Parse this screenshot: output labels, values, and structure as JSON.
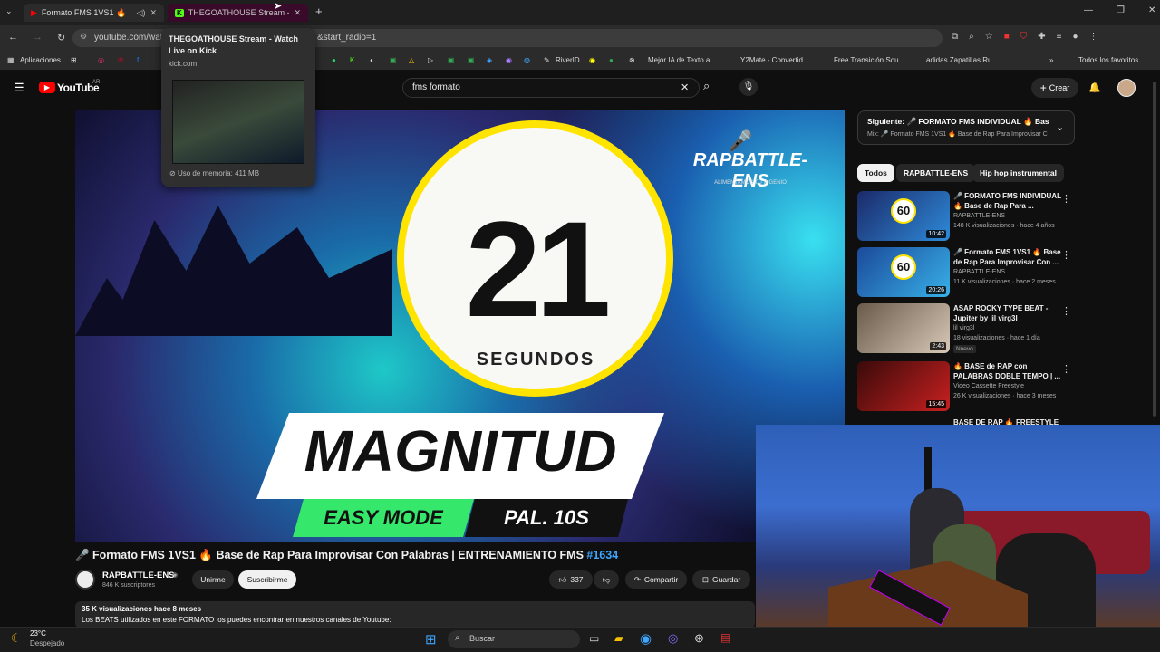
{
  "browser": {
    "tabs": [
      {
        "title": "Formato FMS 1VS1 🔥"
      },
      {
        "title": "THEGOATHOUSE Stream - Watch Live on Kick"
      }
    ],
    "url_visible": "youtube.com/wat",
    "url_tail": "&start_radio=1",
    "bookmarks": [
      "Aplicaciones",
      "RiverID",
      "Mejor IA de Texto a...",
      "Y2Mate - Convertid...",
      "Free Transición Sou...",
      "adidas Zapatillas Ru...",
      "Todos los favoritos"
    ]
  },
  "hover_card": {
    "title": "THEGOATHOUSE Stream - Watch Live on Kick",
    "domain": "kick.com",
    "memory": "Uso de memoria: 411 MB"
  },
  "youtube": {
    "logo": "YouTube",
    "country": "AR",
    "search_value": "fms formato",
    "create_label": "Crear"
  },
  "video": {
    "thumb_number": "21",
    "thumb_seconds": "SEGUNDOS",
    "thumb_word": "MAGNITUD",
    "thumb_mode": "EASY MODE",
    "thumb_pal": "PAL. 10S",
    "thumb_brand": "RAPBATTLE-ENS",
    "thumb_brand_sub": "ALIMENTAMOS TU INGENIO",
    "title": "🎤 Formato FMS 1VS1 🔥 Base de Rap Para Improvisar Con Palabras | ENTRENAMIENTO FMS",
    "hashtag": "#1634",
    "channel": "RAPBATTLE-ENS",
    "subscribers": "846 K suscriptores",
    "join_label": "Unirme",
    "subscribe_label": "Suscribirme",
    "likes": "337",
    "share_label": "Compartir",
    "save_label": "Guardar",
    "views": "35 K visualizaciones  hace 8 meses",
    "desc_line": "Los BEATS utilizados en este FORMATO los puedes encontrar en nuestros canales de Youtube:"
  },
  "sidebar": {
    "next_label": "Siguiente: 🎤 FORMATO FMS INDIVIDUAL 🔥 Base...",
    "mix_label": "Mix: 🎤 Formato FMS 1VS1 🔥 Base de Rap Para Improvisar C",
    "chips": [
      "Todos",
      "RAPBATTLE-ENS",
      "Hip hop instrumental"
    ],
    "items": [
      {
        "title": "🎤 FORMATO FMS INDIVIDUAL\n🔥 Base de Rap Para ...",
        "channel": "RAPBATTLE-ENS",
        "meta": "148 K visualizaciones · hace 4 años",
        "duration": "10:42",
        "badge": ""
      },
      {
        "title": "🎤 Formato FMS 1VS1 🔥 Base\nde Rap Para Improvisar Con ...",
        "channel": "RAPBATTLE-ENS",
        "meta": "11 K visualizaciones · hace 2 meses",
        "duration": "20:26",
        "badge": ""
      },
      {
        "title": "ASAP ROCKY TYPE BEAT -\nJupiter by lil virg3l",
        "channel": "lil virg3l",
        "meta": "18 visualizaciones · hace 1 día",
        "duration": "2:43",
        "badge": "Nuevo"
      },
      {
        "title": "🔥 BASE de RAP con\nPALABRAS DOBLE TEMPO | ...",
        "channel": "Video Cassette Freestyle",
        "meta": "26 K visualizaciones · hace 3 meses",
        "duration": "15:45",
        "badge": ""
      },
      {
        "title": "BASE DE RAP 🔥 FREESTYLE",
        "channel": "",
        "meta": "",
        "duration": "",
        "badge": ""
      }
    ]
  },
  "taskbar": {
    "temp": "23°C",
    "weather": "Despejado",
    "search_label": "Buscar"
  }
}
